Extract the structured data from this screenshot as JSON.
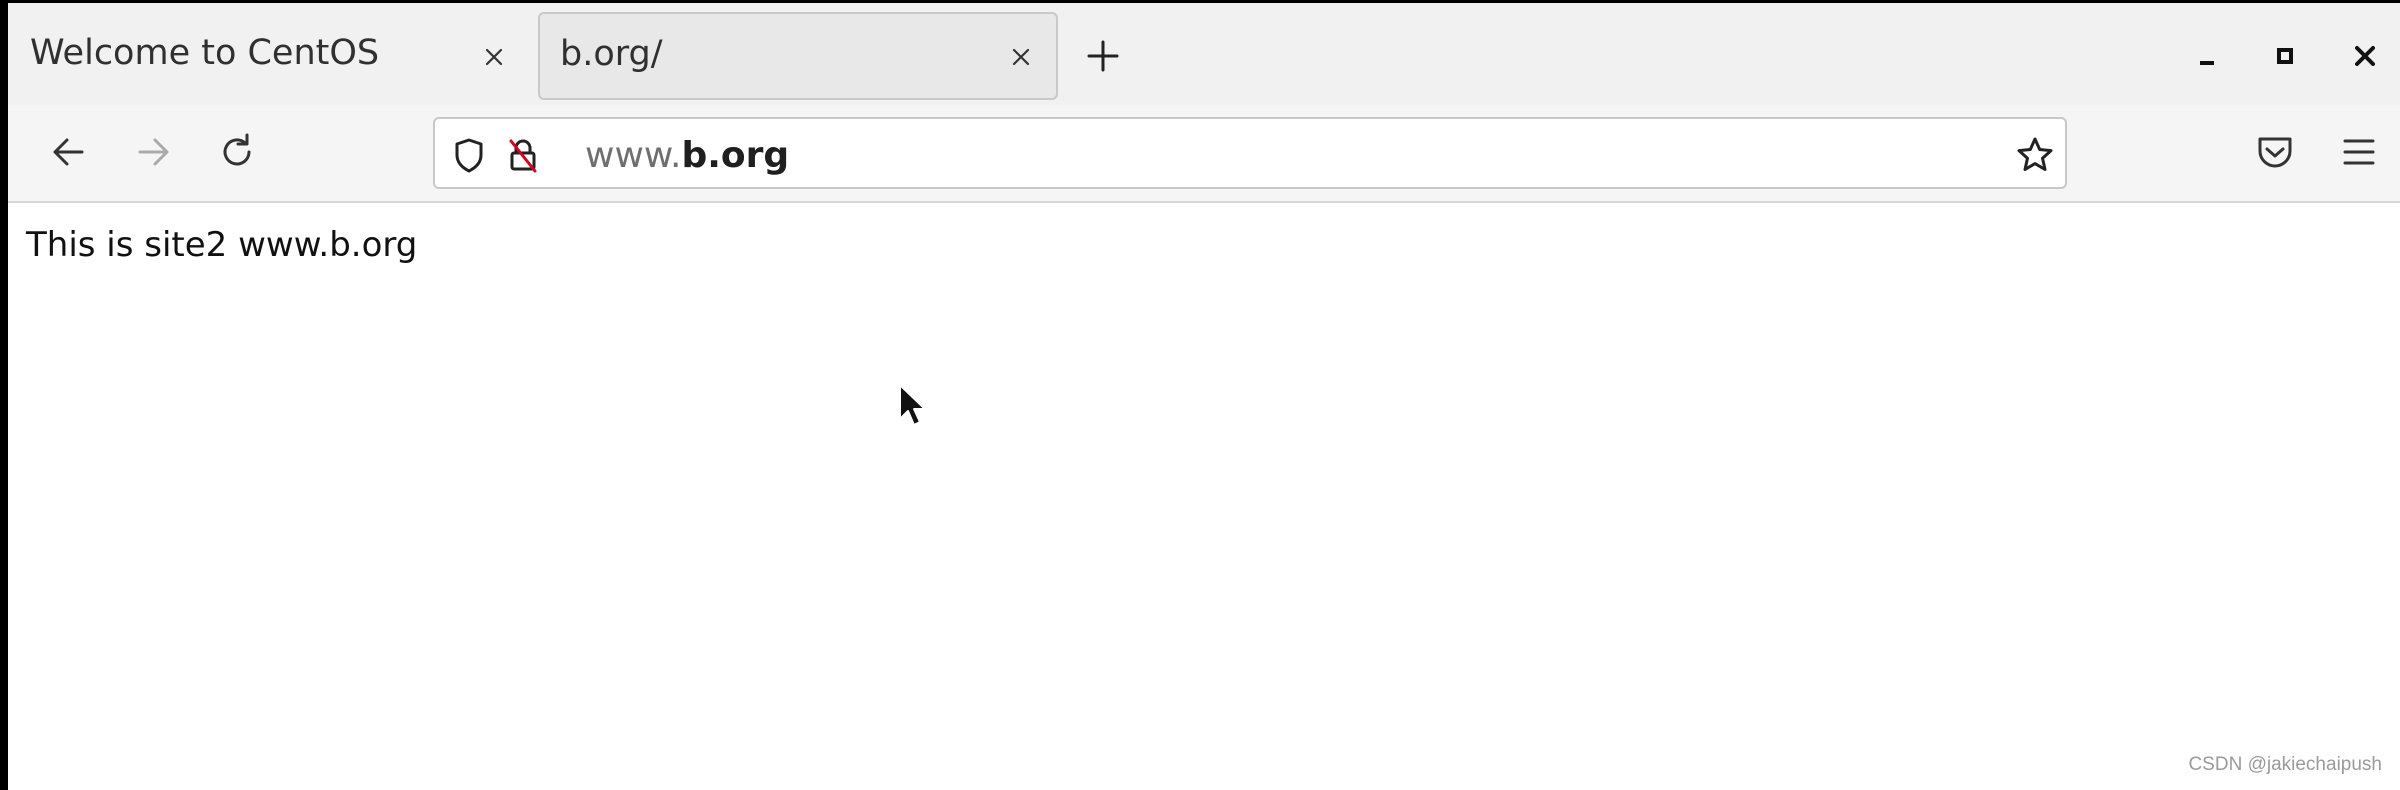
{
  "tabs": [
    {
      "title": "Welcome to CentOS",
      "active": false
    },
    {
      "title": "b.org/",
      "active": true
    }
  ],
  "window_controls": [
    "minimize-icon",
    "maximize-icon",
    "close-icon"
  ],
  "toolbar": {
    "back_icon": "back-arrow-icon",
    "forward_icon": "forward-arrow-icon",
    "reload_icon": "reload-icon",
    "pocket_icon": "pocket-icon",
    "menu_icon": "hamburger-menu-icon"
  },
  "urlbar": {
    "prefix": "www.",
    "domain": "b.org",
    "shield_icon": "tracking-shield-icon",
    "lock_icon": "insecure-lock-icon",
    "bookmark_icon": "bookmark-star-icon"
  },
  "page": {
    "body_text": "This is site2 www.b.org"
  },
  "watermark": "CSDN @jakiechaipush",
  "colors": {
    "tabbar_bg": "#f1f1f1",
    "active_tab_bg": "#e8e8e8",
    "toolbar_bg": "#f5f5f5",
    "insecure_slash": "#d70022"
  }
}
